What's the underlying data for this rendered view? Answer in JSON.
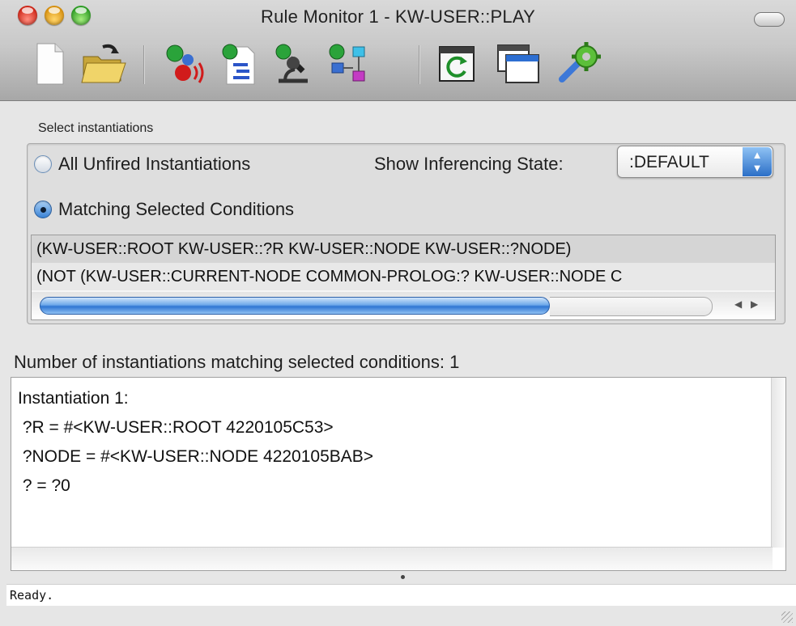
{
  "window": {
    "title": "Rule Monitor 1 - KW-USER::PLAY"
  },
  "toolbar": {
    "icons": [
      "new-document-icon",
      "open-folder-icon",
      "rules-sound-icon",
      "rule-document-icon",
      "inspect-rule-icon",
      "rule-network-icon",
      "refresh-window-icon",
      "new-window-icon",
      "settings-gear-icon"
    ]
  },
  "select_section": {
    "label": "Select instantiations",
    "options": {
      "all_unfired": "All Unfired Instantiations",
      "matching_selected": "Matching Selected Conditions",
      "selected": "matching_selected"
    },
    "inferencing_state": {
      "label": "Show Inferencing State:",
      "value": ":DEFAULT"
    },
    "conditions": [
      "(KW-USER::ROOT KW-USER::?R KW-USER::NODE KW-USER::?NODE)",
      "(NOT (KW-USER::CURRENT-NODE COMMON-PROLOG:? KW-USER::NODE C"
    ]
  },
  "results": {
    "count_label": "Number of instantiations matching selected conditions: 1",
    "lines": [
      "Instantiation 1:",
      " ?R = #<KW-USER::ROOT 4220105C53>",
      " ?NODE = #<KW-USER::NODE 4220105BAB>",
      " ? = ?0"
    ]
  },
  "status": {
    "text": "Ready."
  },
  "colors": {
    "accent": "#3a83d6",
    "window_bg": "#e6e6e6"
  }
}
